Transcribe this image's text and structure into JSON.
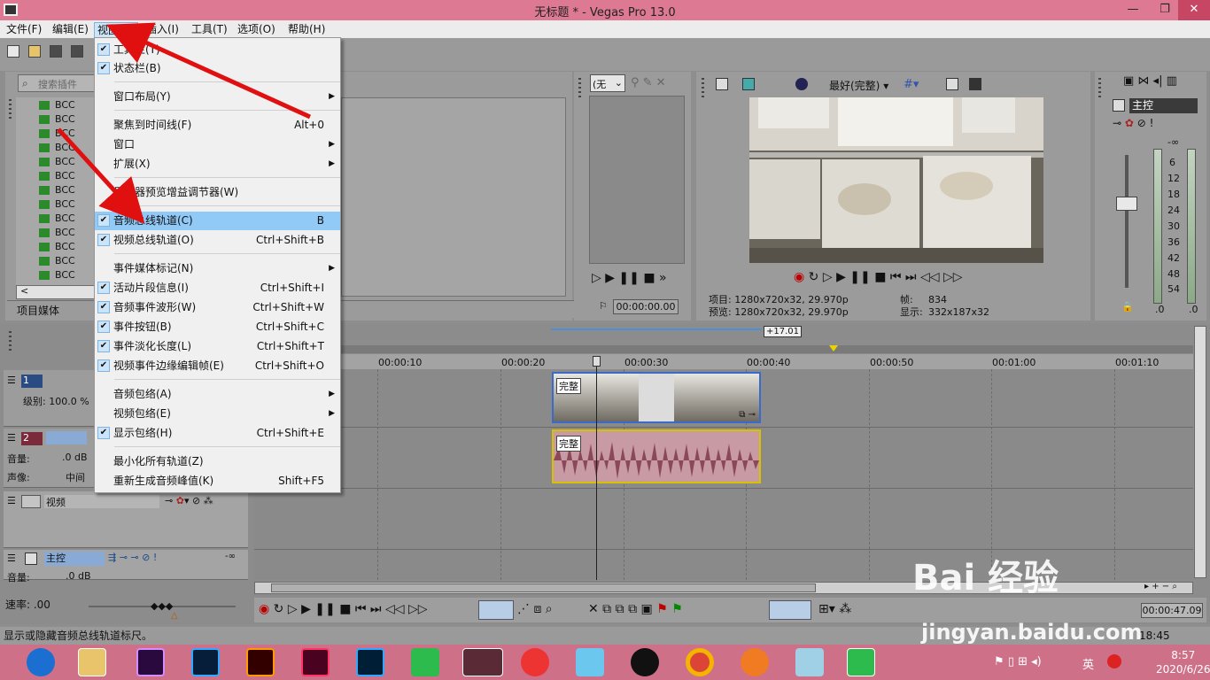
{
  "window": {
    "title": "无标题 * - Vegas Pro 13.0"
  },
  "menubar": [
    {
      "label": "文件(F)"
    },
    {
      "label": "编辑(E)"
    },
    {
      "label": "视图(V)"
    },
    {
      "label": "插入(I)"
    },
    {
      "label": "工具(T)"
    },
    {
      "label": "选项(O)"
    },
    {
      "label": "帮助(H)"
    }
  ],
  "view_menu": {
    "items": [
      {
        "label": "工具栏(T)",
        "checked": true
      },
      {
        "label": "状态栏(B)",
        "checked": true
      },
      {
        "label": "窗口布局(Y)",
        "submenu": true
      },
      {
        "label": "聚焦到时间线(F)",
        "shortcut": "Alt+0"
      },
      {
        "label": "窗口",
        "submenu": true
      },
      {
        "label": "扩展(X)",
        "submenu": true
      },
      {
        "label": "显示器预览增益调节器(W)"
      },
      {
        "label": "音频总线轨道(C)",
        "shortcut": "B",
        "checked": true,
        "highlighted": true
      },
      {
        "label": "视频总线轨道(O)",
        "shortcut": "Ctrl+Shift+B",
        "checked": true
      },
      {
        "label": "事件媒体标记(N)",
        "submenu": true
      },
      {
        "label": "活动片段信息(I)",
        "shortcut": "Ctrl+Shift+I",
        "checked": true
      },
      {
        "label": "音频事件波形(W)",
        "shortcut": "Ctrl+Shift+W",
        "checked": true
      },
      {
        "label": "事件按钮(B)",
        "shortcut": "Ctrl+Shift+C",
        "checked": true
      },
      {
        "label": "事件淡化长度(L)",
        "shortcut": "Ctrl+Shift+T",
        "checked": true
      },
      {
        "label": "视频事件边缘编辑帧(E)",
        "shortcut": "Ctrl+Shift+O",
        "checked": true
      },
      {
        "label": "音频包络(A)",
        "submenu": true
      },
      {
        "label": "视频包络(E)",
        "submenu": true
      },
      {
        "label": "显示包络(H)",
        "shortcut": "Ctrl+Shift+E",
        "checked": true
      },
      {
        "label": "最小化所有轨道(Z)"
      },
      {
        "label": "重新生成音频峰值(K)",
        "shortcut": "Shift+F5"
      }
    ]
  },
  "explorer": {
    "search_placeholder": "搜索插件",
    "tree_items": [
      "BCC",
      "BCC",
      "BCC",
      "BCC",
      "BCC",
      "BCC",
      "BCC",
      "BCC",
      "BCC",
      "BCC",
      "BCC",
      "BCC",
      "BCC"
    ],
    "tab_label": "项目媒体"
  },
  "trimmer": {
    "select_value": "(无",
    "timecode": "00:00:00.00"
  },
  "preview": {
    "quality": "最好(完整)",
    "project_label": "项目: 1280x720x32, 29.970p",
    "preview_label": "预览: 1280x720x32, 29.970p",
    "frame_label": "帧:",
    "frame_value": "834",
    "display_label": "显示:",
    "display_value": "332x187x32"
  },
  "master": {
    "label": "主控",
    "scale": [
      "-∞",
      "6",
      "12",
      "18",
      "24",
      "30",
      "36",
      "42",
      "48",
      "54",
      ".0",
      ".0"
    ]
  },
  "timeline": {
    "loop_marker": "+17.01",
    "ticks": [
      "00:00:10",
      "00:00:20",
      "00:00:30",
      "00:00:40",
      "00:00:50",
      "00:01:00",
      "00:01:10"
    ],
    "tracks": {
      "video": {
        "num": "1",
        "level": "级别: 100.0 %"
      },
      "audio": {
        "num": "2",
        "vol_label": "音量:",
        "vol_value": ".0 dB",
        "pan_label": "声像:",
        "pan_value": "中间"
      },
      "video_bus": {
        "label": "视频"
      },
      "master_bus": {
        "label": "主控",
        "vol_label": "音量:",
        "vol_value": ".0 dB"
      }
    },
    "clip_label": "完整",
    "end_time": "00:00:47.09"
  },
  "transport": {
    "rate": "速率: .00"
  },
  "status": {
    "text": "显示或隐藏音频总线轨道标尺。",
    "time": "18:45"
  },
  "taskbar": {
    "apps": [
      "windows-start",
      "file-explorer",
      "premiere",
      "photoshop",
      "illustrator",
      "indesign",
      "lightroom",
      "green-app",
      "vegas",
      "ball-app",
      "bird-app",
      "qq",
      "chrome",
      "fox-app",
      "glass-app",
      "green-app-2"
    ],
    "ime": "英",
    "clock_time": "8:57",
    "clock_date": "2020/6/26"
  },
  "watermark": {
    "line1": "Bai 经验",
    "line2": "jingyan.baidu.com"
  },
  "colors": {
    "titlebar": "#dd7993",
    "taskbar": "#ce7088",
    "menu_highlight": "#91c9f7",
    "audio_clip": "#c89aa4",
    "video_clip_border": "#3a6bc8"
  }
}
